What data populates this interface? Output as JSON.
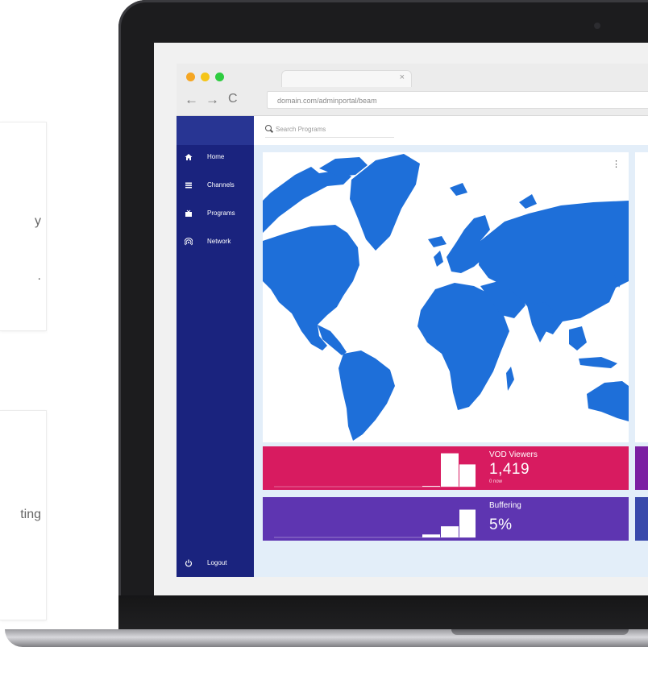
{
  "marketing": {
    "card1_fragments": [
      "y",
      "."
    ],
    "card2_fragment": "ting"
  },
  "browser": {
    "tab_close": "×",
    "back_icon": "←",
    "forward_icon": "→",
    "reload_icon": "C",
    "url": "domain.com/adminportal/beam",
    "traffic_lights": [
      "#f5a623",
      "#f5c518",
      "#2ecc40"
    ]
  },
  "search": {
    "placeholder": "Search Programs"
  },
  "sidebar": {
    "items": [
      {
        "label": "Home",
        "icon": "home-icon"
      },
      {
        "label": "Channels",
        "icon": "list-icon"
      },
      {
        "label": "Programs",
        "icon": "tv-icon"
      },
      {
        "label": "Network",
        "icon": "broadcast-icon"
      }
    ],
    "logout": {
      "label": "Logout",
      "icon": "power-icon"
    }
  },
  "map": {
    "menu_icon": "⋮",
    "land_color": "#1e6fd9"
  },
  "stats": [
    {
      "label": "VOD Viewers",
      "value": "1,419",
      "sub": "0 now",
      "color": "#d81b60",
      "levels": [
        0,
        0,
        0,
        0,
        0,
        0,
        0,
        0,
        0.02,
        0.9,
        0.6
      ]
    },
    {
      "label": "Buffering",
      "value": "5%",
      "sub": "",
      "color": "#5e35b1",
      "levels": [
        0,
        0,
        0,
        0,
        0,
        0,
        0,
        0,
        0.08,
        0.3,
        0.75
      ]
    }
  ],
  "colors": {
    "sidebar": "#1a237e",
    "content_bg": "#e3eef9"
  }
}
